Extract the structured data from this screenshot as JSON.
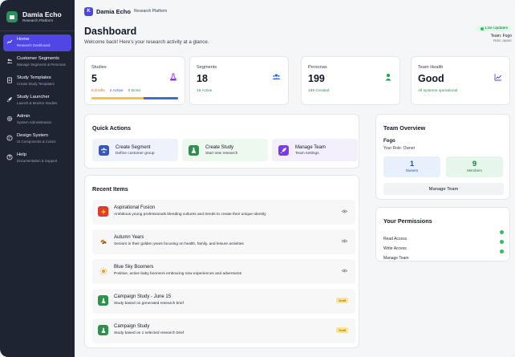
{
  "sidebar": {
    "brand_name": "Damia Echo",
    "brand_sub": "Research Platform",
    "items": [
      {
        "label": "Home",
        "sub": "Research Dashboard",
        "icon": "chart-icon",
        "active": true
      },
      {
        "label": "Customer Segments",
        "sub": "Manage Segments & Personas",
        "icon": "users-icon",
        "active": false
      },
      {
        "label": "Study Templates",
        "sub": "Create Study Templates",
        "icon": "document-icon",
        "active": false
      },
      {
        "label": "Study Launcher",
        "sub": "Launch & Monitor Studies",
        "icon": "rocket-icon",
        "active": false
      },
      {
        "label": "Admin",
        "sub": "System Administration",
        "icon": "gear-icon",
        "active": false
      },
      {
        "label": "Design System",
        "sub": "UI Components & Colors",
        "icon": "palette-icon",
        "active": false
      },
      {
        "label": "Help",
        "sub": "Documentation & Support",
        "icon": "help-icon",
        "active": false
      }
    ]
  },
  "topbar": {
    "logo_letter": "K",
    "brand": "Damia Echo",
    "sub": "Research Platform"
  },
  "header": {
    "title": "Dashboard",
    "subtitle": "Welcome back! Here's your research activity at a glance.",
    "live_label": "Live Updates",
    "team_label": "Team: Fogo",
    "role_label": "Role: owner"
  },
  "stats": [
    {
      "label": "Studies",
      "value": "5",
      "drafts": "5 Drafts",
      "active": "2 Active",
      "done": "0 Done",
      "progress": {
        "drafts": 0.6,
        "active": 0.4,
        "done": 0.0
      }
    },
    {
      "label": "Segments",
      "value": "18",
      "foot": "18 Active"
    },
    {
      "label": "Personas",
      "value": "199",
      "foot": "199 Created"
    },
    {
      "label": "Team Health",
      "value": "Good",
      "foot": "All systems operational"
    }
  ],
  "quick_actions": {
    "title": "Quick Actions",
    "items": [
      {
        "title": "Create Segment",
        "sub": "Define customer group"
      },
      {
        "title": "Create Study",
        "sub": "Start new research"
      },
      {
        "title": "Manage Team",
        "sub": "Team settings"
      }
    ]
  },
  "recent": {
    "title": "Recent Items",
    "items": [
      {
        "title": "Aspirational Fusion",
        "sub": "Ambitious young professionals blending cultures and trends to create their unique identity",
        "badge": ""
      },
      {
        "title": "Autumn Years",
        "sub": "Seniors in their golden years focusing on health, family, and leisure activities",
        "badge": ""
      },
      {
        "title": "Blue Sky Boomers",
        "sub": "Positive, active baby boomers embracing new experiences and adventures",
        "badge": ""
      },
      {
        "title": "Campaign Study - June 15",
        "sub": "Study based on generated research brief",
        "badge": "Draft"
      },
      {
        "title": "Campaign Study",
        "sub": "Study based on 1 selected research brief",
        "badge": "Draft"
      }
    ]
  },
  "team_overview": {
    "title": "Team Overview",
    "name": "Fogo",
    "role": "Your Role: Owner",
    "owners_value": "1",
    "owners_label": "Owners",
    "members_value": "9",
    "members_label": "Members",
    "button": "Manage Team"
  },
  "permissions": {
    "title": "Your Permissions",
    "items": [
      "Read Access",
      "Write Access",
      "Manage Team"
    ]
  },
  "colors": {
    "accent": "#4f46e5",
    "sidebar_bg": "#1f2433",
    "success": "#22c55e",
    "progress_drafts": "#f6c343",
    "progress_active": "#3b6fd8"
  }
}
